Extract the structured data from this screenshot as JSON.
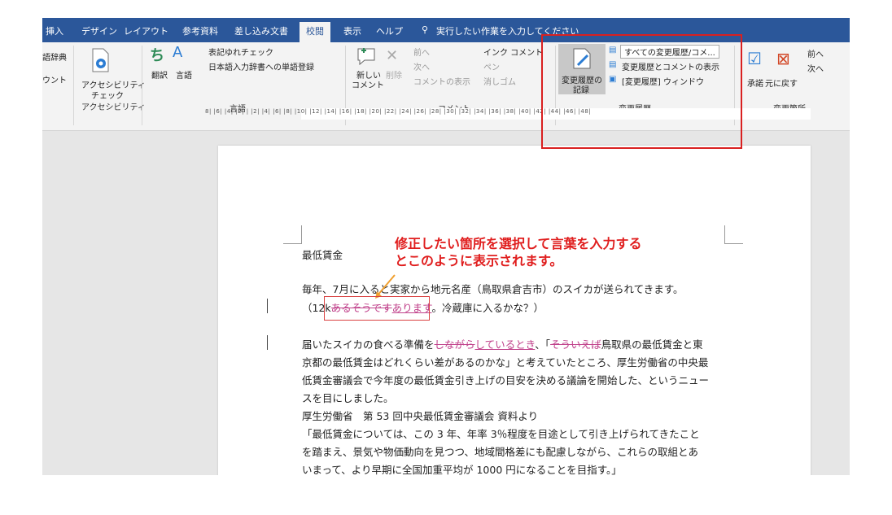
{
  "tabs": [
    "挿入",
    "デザイン",
    "レイアウト",
    "参考資料",
    "差し込み文書",
    "校閲",
    "表示",
    "ヘルプ"
  ],
  "tellme": "実行したい作業を入力してください",
  "ribbon": {
    "left_cut": [
      "語辞典",
      "ウント"
    ],
    "accessibility": {
      "btn": "アクセシビリティ",
      "btn2": "チェック",
      "group": "アクセシビリティ"
    },
    "translate": "翻訳",
    "language": "言語",
    "lang_opt1": "表記ゆれチェック",
    "lang_opt2": "日本語入力辞書への単語登録",
    "lang_group": "言語",
    "new_comment1": "新しい",
    "new_comment2": "コメント",
    "delete": "削除",
    "prev": "前へ",
    "next": "次へ",
    "show_comments": "コメントの表示",
    "ink_comment": "インク コメント",
    "pen": "ペン",
    "eraser": "消しゴム",
    "comment_group": "コメント",
    "track1": "変更履歴の",
    "track2": "記録",
    "markup_dropdown": "すべての変更履歴/コメ...",
    "show_markup": "変更履歴とコメントの表示",
    "pane": "[変更履歴] ウィンドウ",
    "track_group": "変更履歴",
    "accept": "承諾",
    "reject": "元に戻す",
    "chg_prev": "前へ",
    "chg_next": "次へ",
    "changes_group": "変更箇所"
  },
  "ruler": "8| |6| |4| |2| |  |2| |4| |6| |8| |10| |12| |14| |16| |18| |20| |22| |24| |26| |28| |30| |32| |34| |36| |38| |40| |42| |44| |46| |48|",
  "doc": {
    "title": "最低賃金",
    "l2a": "毎年、7月に入ると実家から地元名産（鳥取県倉吉市）のスイカが送られてきます。",
    "l3a": "（12k",
    "l3del": "あるそうです",
    "l3ins": "あります",
    "l3b": "。冷蔵庫に入るかな？）",
    "l4a": "届いたスイカの食べる準備を",
    "l4del": "しながら",
    "l4ins": "しているとき",
    "l4b": "、「",
    "l4del2": "そういえば",
    "l4c": "鳥取県の最低賃金と東",
    "l5": "京都の最低賃金はどれくらい差があるのかな」と考えていたところ、厚生労働省の中央最",
    "l6": "低賃金審議会で今年度の最低賃金引き上げの目安を決める議論を開始した、というニュー",
    "l7": "スを目にしました。",
    "l8": "厚生労働省　第 53 回中央最低賃金審議会 資料より",
    "l9": "「最低賃金については、この 3 年、年率 3％程度を目途として引き上げられてきたこと",
    "l10": "を踏まえ、景気や物価動向を見つつ、地域間格差にも配慮しながら、これらの取組とあ",
    "l11": "いまって、より早期に全国加重平均が 1000 円になることを目指す。」"
  },
  "annotation": {
    "line1": "修正したい箇所を選択して言葉を入力する",
    "line2": "とこのように表示されます。"
  },
  "colors": {
    "tab_bar": "#2b579a",
    "annotation": "#e01e1e",
    "revision": "#c0408a"
  }
}
